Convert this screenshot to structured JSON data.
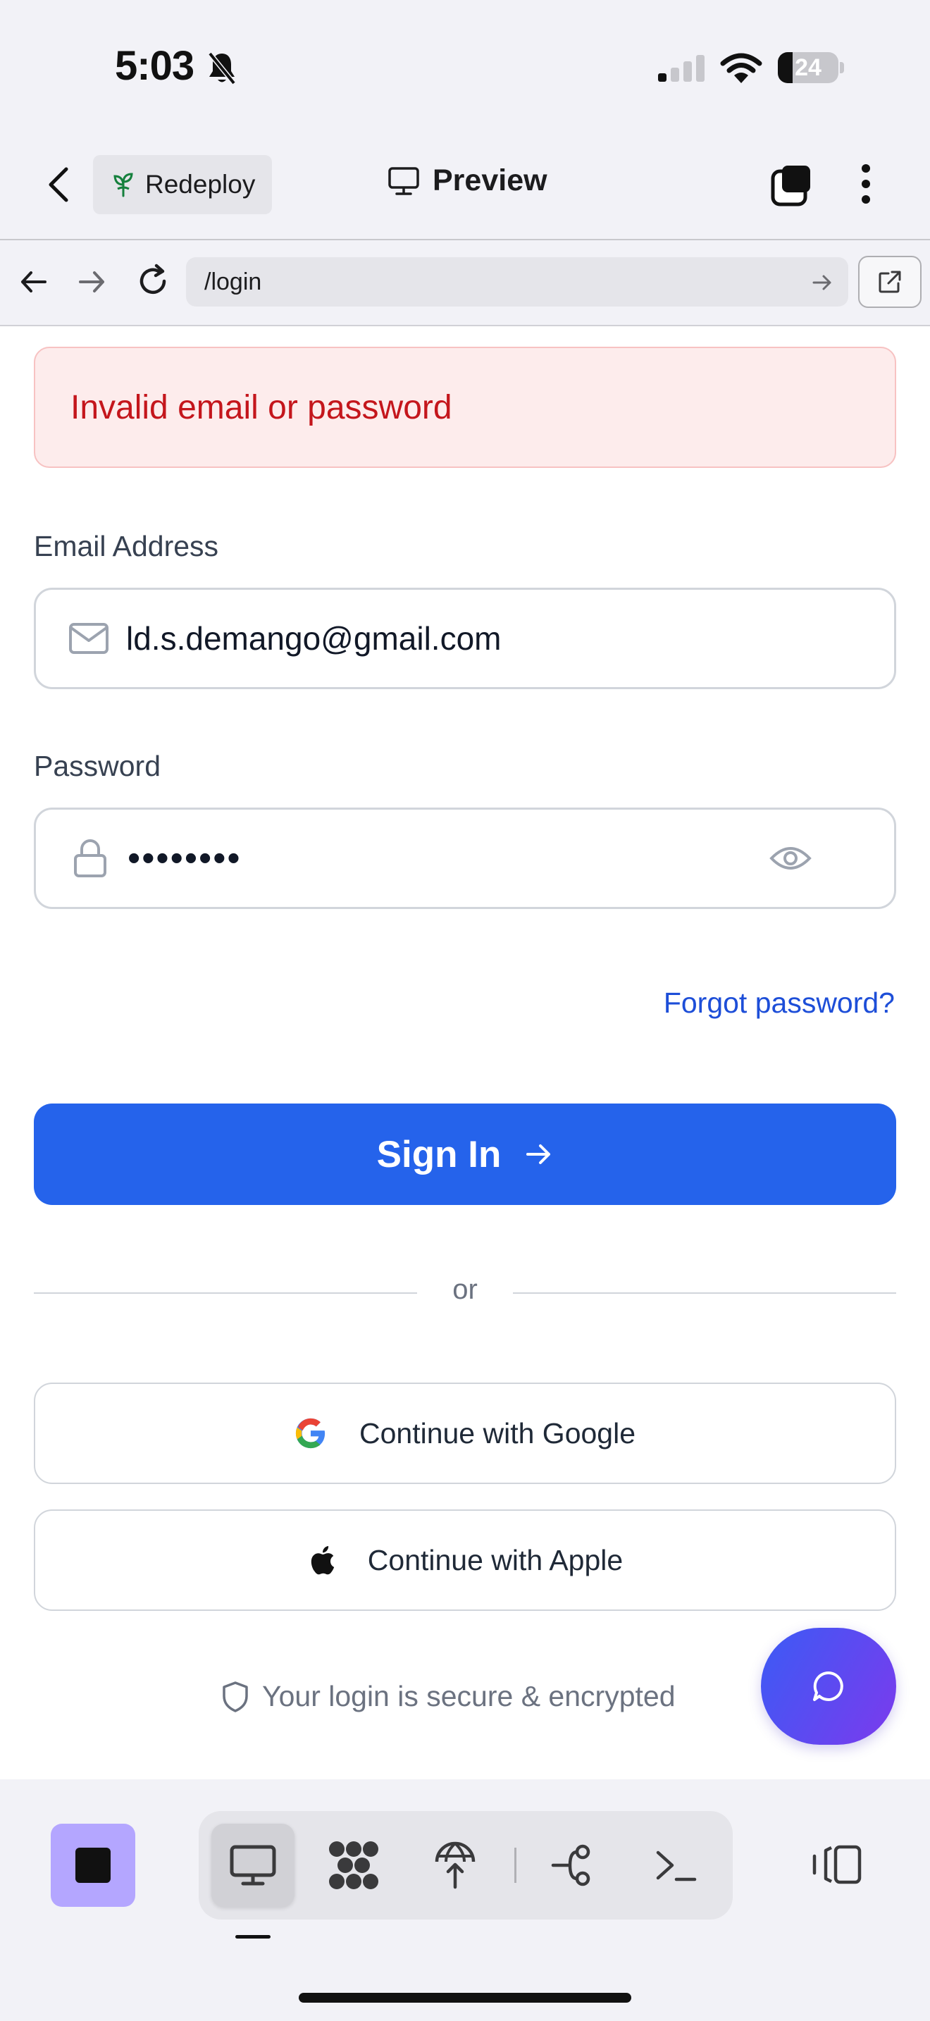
{
  "status_bar": {
    "time": "5:03",
    "battery_percent": "24",
    "battery_level": 0.24,
    "signal_bars_active": 1
  },
  "header": {
    "redeploy_label": "Redeploy",
    "preview_title": "Preview"
  },
  "browser": {
    "url": "/login"
  },
  "login_form": {
    "error_message": "Invalid email or password",
    "email_label": "Email Address",
    "email_value": "ld.s.demango@gmail.com",
    "password_label": "Password",
    "password_value": "••••••••",
    "forgot_password": "Forgot password?",
    "sign_in_label": "Sign In",
    "or_text": "or",
    "google_label": "Continue with Google",
    "apple_label": "Continue with Apple",
    "secure_text": "Your login is secure & encrypted"
  },
  "colors": {
    "primary": "#2563eb",
    "error_text": "#c4161c",
    "error_bg": "#fdecec",
    "link": "#1d4ed8",
    "app_accent": "#b4a6ff",
    "fab_gradient_start": "#3b5bf5",
    "fab_gradient_end": "#7c3aed"
  },
  "icons": {
    "status": [
      "bell-slash-icon",
      "cellular-signal-icon",
      "wifi-icon",
      "battery-icon"
    ],
    "header": [
      "back-chevron-icon",
      "sprout-icon",
      "monitor-icon",
      "tabs-icon",
      "more-vertical-icon"
    ],
    "browser": [
      "arrow-left-icon",
      "arrow-right-icon",
      "reload-icon",
      "go-arrow-icon",
      "external-link-icon"
    ],
    "form": [
      "mail-icon",
      "lock-icon",
      "eye-icon",
      "arrow-right-icon",
      "google-icon",
      "apple-icon",
      "shield-icon",
      "chat-bubble-icon"
    ],
    "bottom_bar": [
      "stop-square-icon",
      "monitor-icon",
      "grid-blobs-icon",
      "globe-upload-icon",
      "git-branch-icon",
      "terminal-icon",
      "panel-toggle-icon"
    ]
  }
}
